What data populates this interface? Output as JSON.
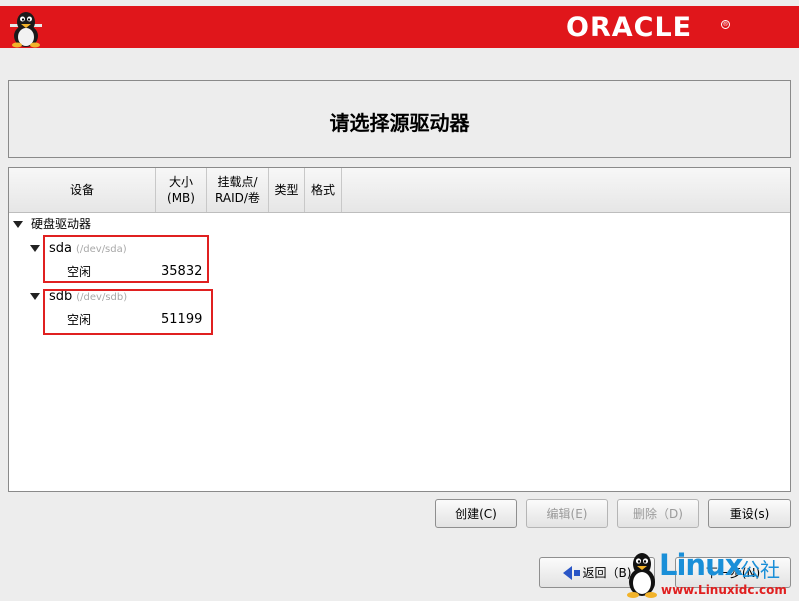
{
  "banner": {
    "logo_text": "ORACLE",
    "registered": "®"
  },
  "header": {
    "title": "请选择源驱动器"
  },
  "table": {
    "columns": {
      "device": "设备",
      "size": "大小\n(MB)",
      "mount": "挂载点/\nRAID/卷",
      "type": "类型",
      "format": "格式"
    },
    "group_label": "硬盘驱动器",
    "drives": [
      {
        "name": "sda",
        "path": "(/dev/sda)",
        "free_label": "空闲",
        "free_size": "35832"
      },
      {
        "name": "sdb",
        "path": "(/dev/sdb)",
        "free_label": "空闲",
        "free_size": "51199"
      }
    ]
  },
  "actions": {
    "create": "创建(C)",
    "edit": "编辑(E)",
    "delete": "删除（D)",
    "reset": "重设(s)"
  },
  "nav": {
    "back": "返回（B)",
    "next": "下一步(N)"
  },
  "watermark": {
    "brand": "Linux",
    "cn": "公社",
    "url": "www.Linuxidc.com"
  },
  "colors": {
    "banner": "#e0161b",
    "highlight": "#e02020",
    "watermark": "#1a8fd8"
  }
}
